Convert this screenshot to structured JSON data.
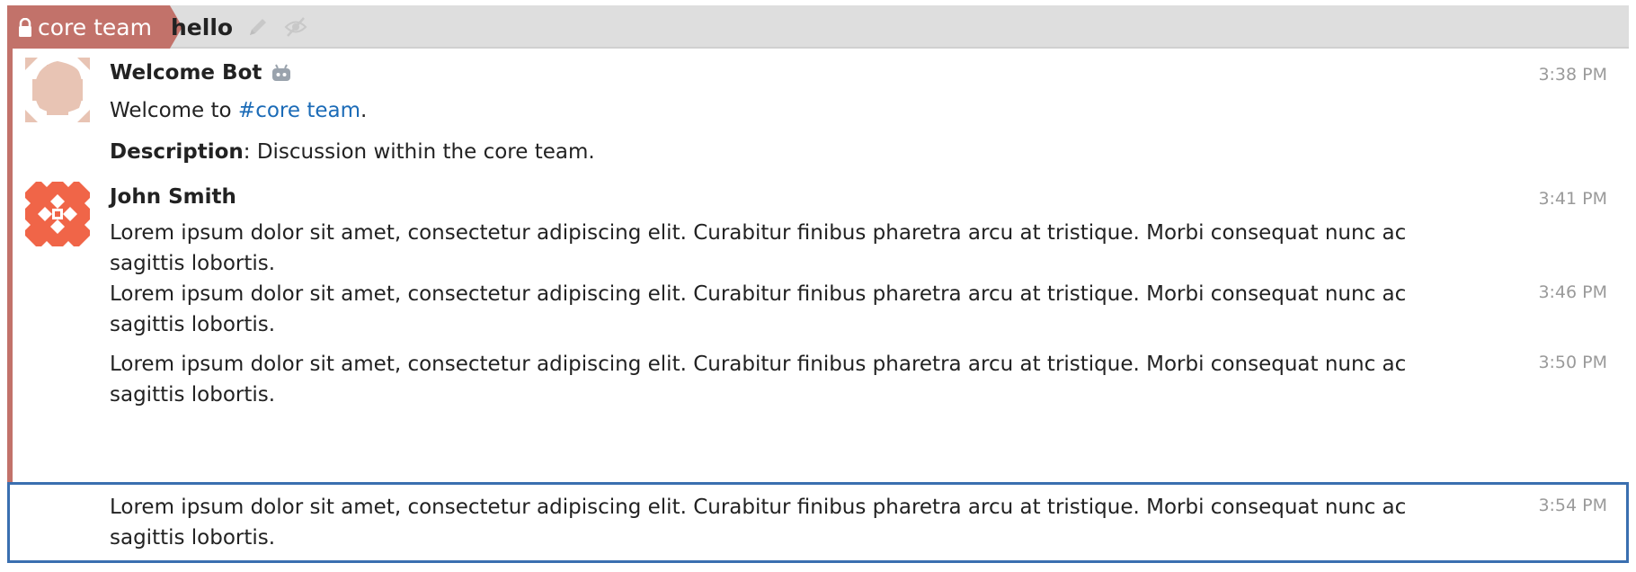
{
  "header": {
    "stream_name": "core team",
    "topic_name": "hello"
  },
  "messages": [
    {
      "sender": "Welcome Bot",
      "time": "3:38 PM",
      "welcome_prefix": "Welcome to ",
      "welcome_link": "#core team",
      "welcome_suffix": ".",
      "description_label": "Description",
      "description_text": ": Discussion within the core team."
    },
    {
      "sender": "John Smith",
      "time": "3:41 PM",
      "text": "Lorem ipsum dolor sit amet, consectetur adipiscing elit. Curabitur finibus pharetra arcu at tristique. Morbi consequat nunc ac sagittis lobortis."
    },
    {
      "time": "3:46 PM",
      "text": "Lorem ipsum dolor sit amet, consectetur adipiscing elit. Curabitur finibus pharetra arcu at tristique. Morbi consequat nunc ac sagittis lobortis."
    },
    {
      "time": "3:50 PM",
      "text": "Lorem ipsum dolor sit amet, consectetur adipiscing elit. Curabitur finibus pharetra arcu at tristique. Morbi consequat nunc ac sagittis lobortis."
    },
    {
      "time": "3:54 PM",
      "text": "Lorem ipsum dolor sit amet, consectetur adipiscing elit. Curabitur finibus pharetra arcu at tristique. Morbi consequat nunc ac sagittis lobortis."
    }
  ],
  "icons": {
    "lock": "lock-icon",
    "edit": "pencil-icon",
    "mute": "eye-slash-icon",
    "bot": "bot-icon"
  },
  "colors": {
    "stream": "#c2726a",
    "link": "#1b6bb7",
    "selected_border": "#3a6fb0"
  }
}
